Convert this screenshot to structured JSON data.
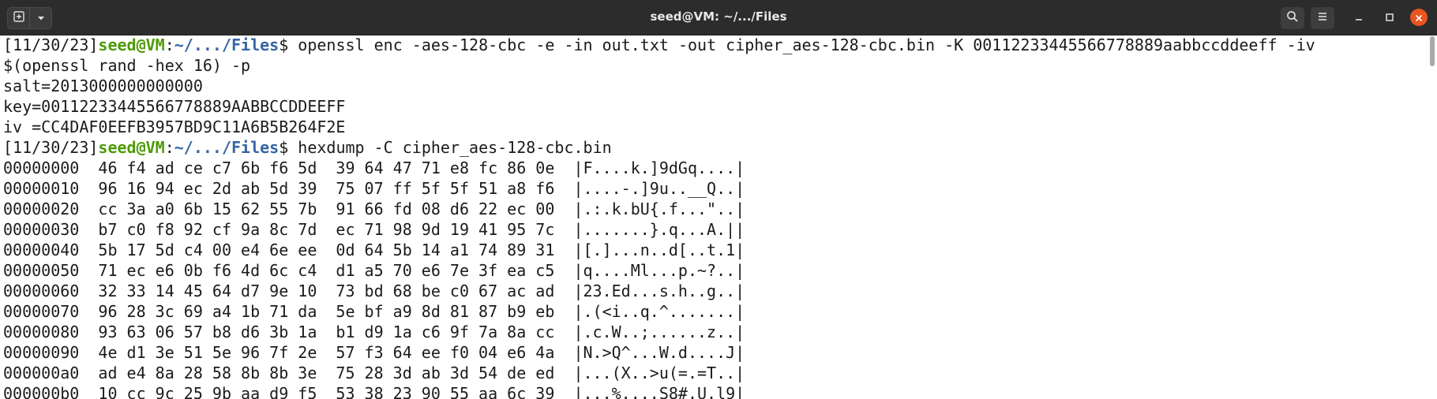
{
  "window": {
    "title": "seed@VM: ~/.../Files"
  },
  "titlebar_icons": {
    "new_tab": "new-tab-icon",
    "menu_dropdown": "chevron-down-icon",
    "search": "search-icon",
    "hamburger": "hamburger-menu-icon",
    "minimize": "minimize-icon",
    "maximize": "maximize-icon",
    "close": "close-icon"
  },
  "colors": {
    "accent": "#e95420",
    "prompt_user": "#4e9a06",
    "prompt_path": "#3465a4"
  },
  "terminal": {
    "cmd1": {
      "date": "[11/30/23]",
      "user": "seed@VM",
      "colon": ":",
      "path": "~/.../Files",
      "dollar": "$",
      "command": " openssl enc -aes-128-cbc -e -in out.txt -out cipher_aes-128-cbc.bin -K 00112233445566778889aabbccddeeff -iv"
    },
    "cmd1_cont": "$(openssl rand -hex 16) -p",
    "output": [
      "salt=2013000000000000",
      "key=00112233445566778889AABBCCDDEEFF",
      "iv =CC4DAF0EEFB3957BD9C11A6B5B264F2E"
    ],
    "cmd2": {
      "date": "[11/30/23]",
      "user": "seed@VM",
      "colon": ":",
      "path": "~/.../Files",
      "dollar": "$",
      "command": " hexdump -C cipher_aes-128-cbc.bin"
    },
    "hexdump": [
      "00000000  46 f4 ad ce c7 6b f6 5d  39 64 47 71 e8 fc 86 0e  |F....k.]9dGq....|",
      "00000010  96 16 94 ec 2d ab 5d 39  75 07 ff 5f 5f 51 a8 f6  |....-.]9u..__Q..|",
      "00000020  cc 3a a0 6b 15 62 55 7b  91 66 fd 08 d6 22 ec 00  |.:.k.bU{.f...\"..|",
      "00000030  b7 c0 f8 92 cf 9a 8c 7d  ec 71 98 9d 19 41 95 7c  |.......}.q...A.||",
      "00000040  5b 17 5d c4 00 e4 6e ee  0d 64 5b 14 a1 74 89 31  |[.]...n..d[..t.1|",
      "00000050  71 ec e6 0b f6 4d 6c c4  d1 a5 70 e6 7e 3f ea c5  |q....Ml...p.~?..|",
      "00000060  32 33 14 45 64 d7 9e 10  73 bd 68 be c0 67 ac ad  |23.Ed...s.h..g..|",
      "00000070  96 28 3c 69 a4 1b 71 da  5e bf a9 8d 81 87 b9 eb  |.(<i..q.^.......|",
      "00000080  93 63 06 57 b8 d6 3b 1a  b1 d9 1a c6 9f 7a 8a cc  |.c.W..;......z..|",
      "00000090  4e d1 3e 51 5e 96 7f 2e  57 f3 64 ee f0 04 e6 4a  |N.>Q^...W.d....J|",
      "000000a0  ad e4 8a 28 58 8b 8b 3e  75 28 3d ab 3d 54 de ed  |...(X..>u(=.=T..|",
      "000000b0  10 cc 9c 25 9b aa d9 f5  53 38 23 90 55 aa 6c 39  |...%....S8#.U.l9|"
    ]
  }
}
